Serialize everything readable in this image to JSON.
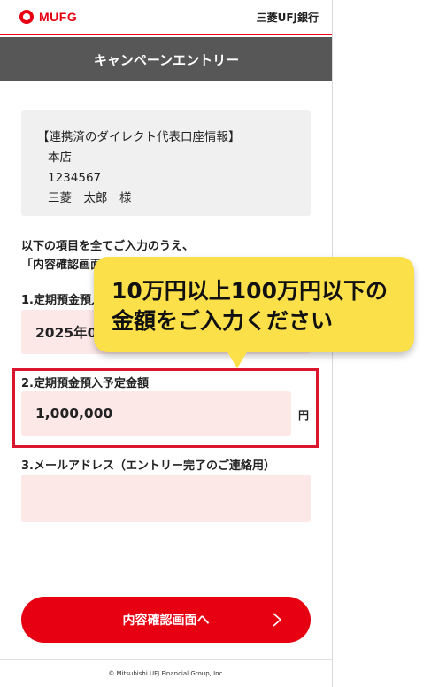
{
  "header": {
    "logo_text": "MUFG",
    "bank_name": "三菱UFJ銀行"
  },
  "titlebar": {
    "title": "キャンペーンエントリー"
  },
  "info": {
    "heading": "【連携済のダイレクト代表口座情報】",
    "branch": "本店",
    "account_number": "1234567",
    "holder": "三菱　太郎　様"
  },
  "lead": {
    "line1": "以下の項目を全てご入力のうえ、",
    "line2": "「内容確認画面へ」"
  },
  "fields": {
    "date_label": "1.定期預金預入",
    "date_value": "2025年0",
    "amount_label": "2.定期預金預入予定金額",
    "amount_value": "1,000,000",
    "amount_unit": "円",
    "email_label": "3.メールアドレス（エントリー完了のご連絡用）",
    "email_value": ""
  },
  "tooltip": {
    "line1": "10万円以上100万円以下の",
    "line2": "金額をご入力ください"
  },
  "cta": {
    "label": "内容確認画面へ",
    "icon": "chevron-right-icon"
  },
  "footer": {
    "copyright": "© Mitsubishi UFJ Financial Group, Inc."
  },
  "colors": {
    "brand_red": "#e60012",
    "field_bg": "#fde8e8",
    "tooltip_bg": "#fce04a",
    "titlebar_bg": "#575757"
  }
}
